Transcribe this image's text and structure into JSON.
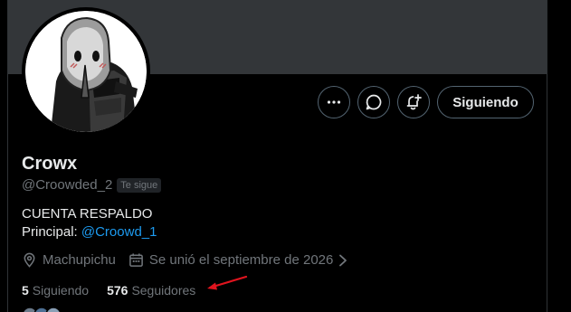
{
  "profile": {
    "display_name": "Crowx",
    "handle": "@Croowded_2",
    "follows_you_badge": "Te sigue",
    "bio_line1": "CUENTA RESPALDO",
    "bio_principal_label": "Principal:",
    "bio_principal_link": "@Croowd_1",
    "location": "Machupichu",
    "joined": "Se unió el septiembre de 2026",
    "following_count": "5",
    "following_label": "Siguiendo",
    "followers_count": "576",
    "followers_label": "Seguidores"
  },
  "actions": {
    "more_icon": "more-dots-icon",
    "message_icon": "message-bubble-icon",
    "notify_icon": "bell-plus-icon",
    "follow_label": "Siguiendo"
  },
  "colors": {
    "background": "#000000",
    "banner": "#333639",
    "text_primary": "#e7e9ea",
    "text_secondary": "#71767b",
    "link": "#1d9bf0",
    "annotation_arrow": "#e0141e"
  }
}
